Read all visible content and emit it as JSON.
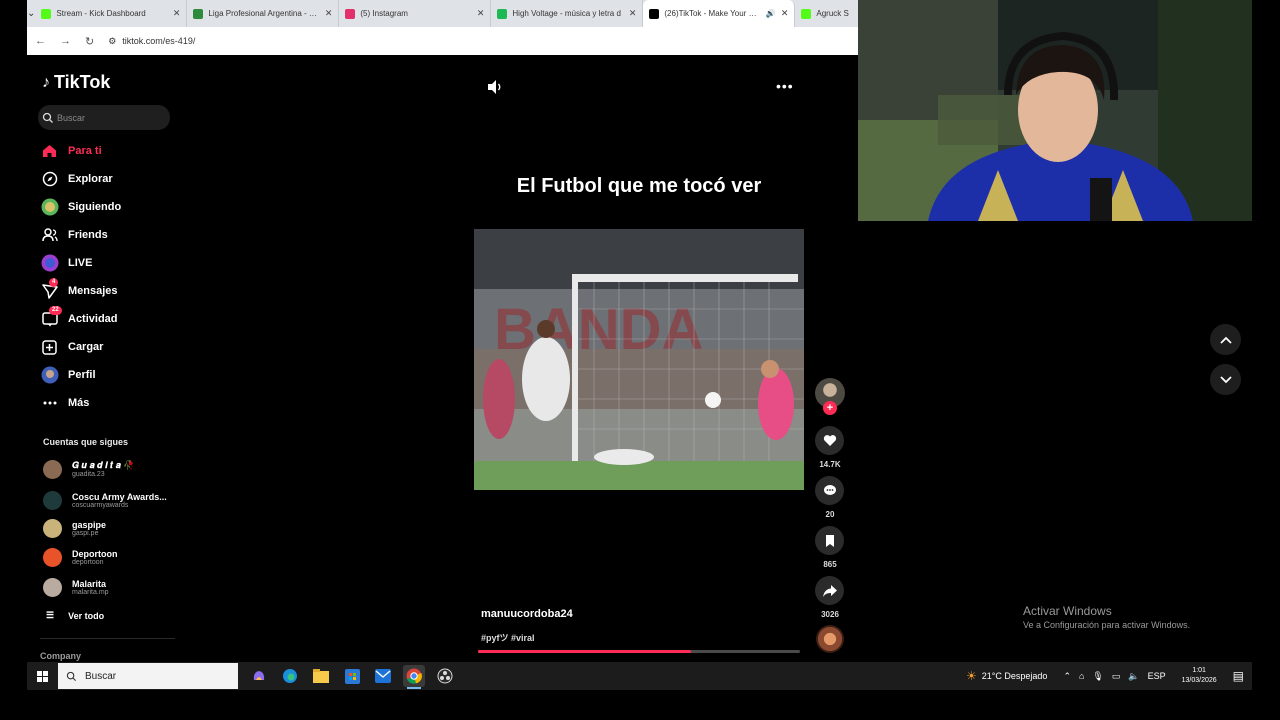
{
  "browser": {
    "tabs": [
      {
        "title": "Stream - Kick Dashboard",
        "color": "#53fc18",
        "active": false
      },
      {
        "title": "Liga Profesional Argentina - PC",
        "color": "#2e8b3e",
        "active": false
      },
      {
        "title": "(5) Instagram",
        "color": "#e1306c",
        "active": false
      },
      {
        "title": "High Voltage - música y letra d",
        "color": "#1db954",
        "active": false
      },
      {
        "title": "(26)TikTok - Make Your Day",
        "color": "#000000",
        "active": true
      },
      {
        "title": "Agruck S",
        "color": "#53fc18",
        "active": false
      }
    ],
    "url": "tiktok.com/es-419/"
  },
  "tiktok": {
    "logo_text": "TikTok",
    "search_placeholder": "Buscar",
    "menu": [
      {
        "label": "Para ti",
        "icon": "home-icon",
        "active": true,
        "badge": ""
      },
      {
        "label": "Explorar",
        "icon": "compass-icon",
        "active": false,
        "badge": ""
      },
      {
        "label": "Siguiendo",
        "icon": "following-avatar-icon",
        "active": false,
        "badge": ""
      },
      {
        "label": "Friends",
        "icon": "friends-icon",
        "active": false,
        "badge": ""
      },
      {
        "label": "LIVE",
        "icon": "live-icon",
        "active": false,
        "badge": ""
      },
      {
        "label": "Mensajes",
        "icon": "messages-icon",
        "active": false,
        "badge": "4"
      },
      {
        "label": "Actividad",
        "icon": "activity-icon",
        "active": false,
        "badge": "22"
      },
      {
        "label": "Cargar",
        "icon": "upload-icon",
        "active": false,
        "badge": ""
      },
      {
        "label": "Perfil",
        "icon": "profile-icon",
        "active": false,
        "badge": ""
      },
      {
        "label": "Más",
        "icon": "more-icon",
        "active": false,
        "badge": ""
      }
    ],
    "following_title": "Cuentas que sigues",
    "following": [
      {
        "name": "𝑮 𝒖 𝒂 𝒅 𝒊 𝒕 𝒂 🥀",
        "handle": "guadita.23",
        "color": "#8a6a52"
      },
      {
        "name": "Coscu Army Awards...",
        "handle": "coscuarmyawards",
        "color": "#1f3a3a"
      },
      {
        "name": "gaspipe",
        "handle": "gaspi.pe",
        "color": "#c9b37a"
      },
      {
        "name": "Deportoon",
        "handle": "deportoon",
        "color": "#e8532a"
      },
      {
        "name": "Malarita",
        "handle": "malarita.mp",
        "color": "#b9aba0"
      }
    ],
    "see_all": "Ver todo",
    "company": "Company"
  },
  "video": {
    "caption": "El Futbol que me tocó ver",
    "author": "manuucordoba24",
    "tags": "#pyfツ #viral",
    "progress": 0.66,
    "likes": "14.7K",
    "comments": "20",
    "saves": "865",
    "shares": "3026"
  },
  "watermark": {
    "line1": "Activar Windows",
    "line2": "Ve a Configuración para activar Windows."
  },
  "taskbar": {
    "search_placeholder": "Buscar",
    "weather": "21°C  Despejado",
    "lang": "ESP",
    "time": "1:01",
    "date": "13/03/2026"
  }
}
